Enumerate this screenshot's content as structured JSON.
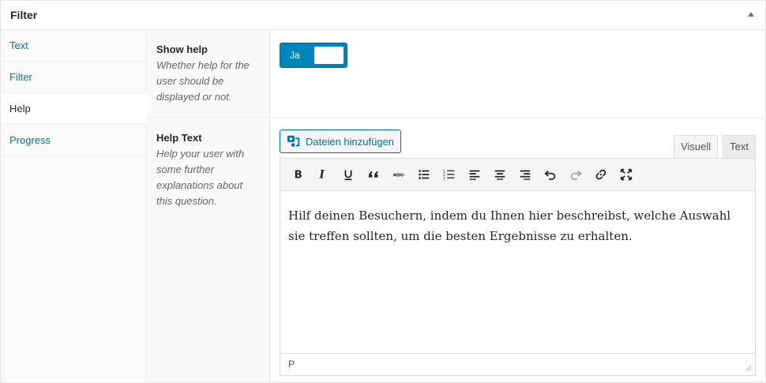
{
  "panel": {
    "title": "Filter"
  },
  "tabs": [
    {
      "label": "Text"
    },
    {
      "label": "Filter"
    },
    {
      "label": "Help"
    },
    {
      "label": "Progress"
    }
  ],
  "fields": {
    "show_help": {
      "title": "Show help",
      "description": "Whether help for the user should be displayed or not.",
      "switch_label": "Ja"
    },
    "help_text": {
      "title": "Help Text",
      "description": "Help your user with some further explanations about this question.",
      "media_button": "Dateien hinzufügen",
      "tab_visual": "Visuell",
      "tab_text": "Text",
      "content": "Hilf deinen Besuchern, indem du Ihnen hier beschreibst, welche Auswahl sie treffen sollten, um die besten Ergebnisse zu erhalten.",
      "status_path": "P"
    }
  },
  "toolbar_icons": [
    "bold-icon",
    "italic-icon",
    "underline-icon",
    "blockquote-icon",
    "strikethrough-icon",
    "bullet-list-icon",
    "numbered-list-icon",
    "align-left-icon",
    "align-center-icon",
    "align-right-icon",
    "undo-icon",
    "redo-icon",
    "link-icon",
    "fullscreen-icon"
  ],
  "colors": {
    "accent": "#0085ba",
    "link": "#0073aa"
  }
}
